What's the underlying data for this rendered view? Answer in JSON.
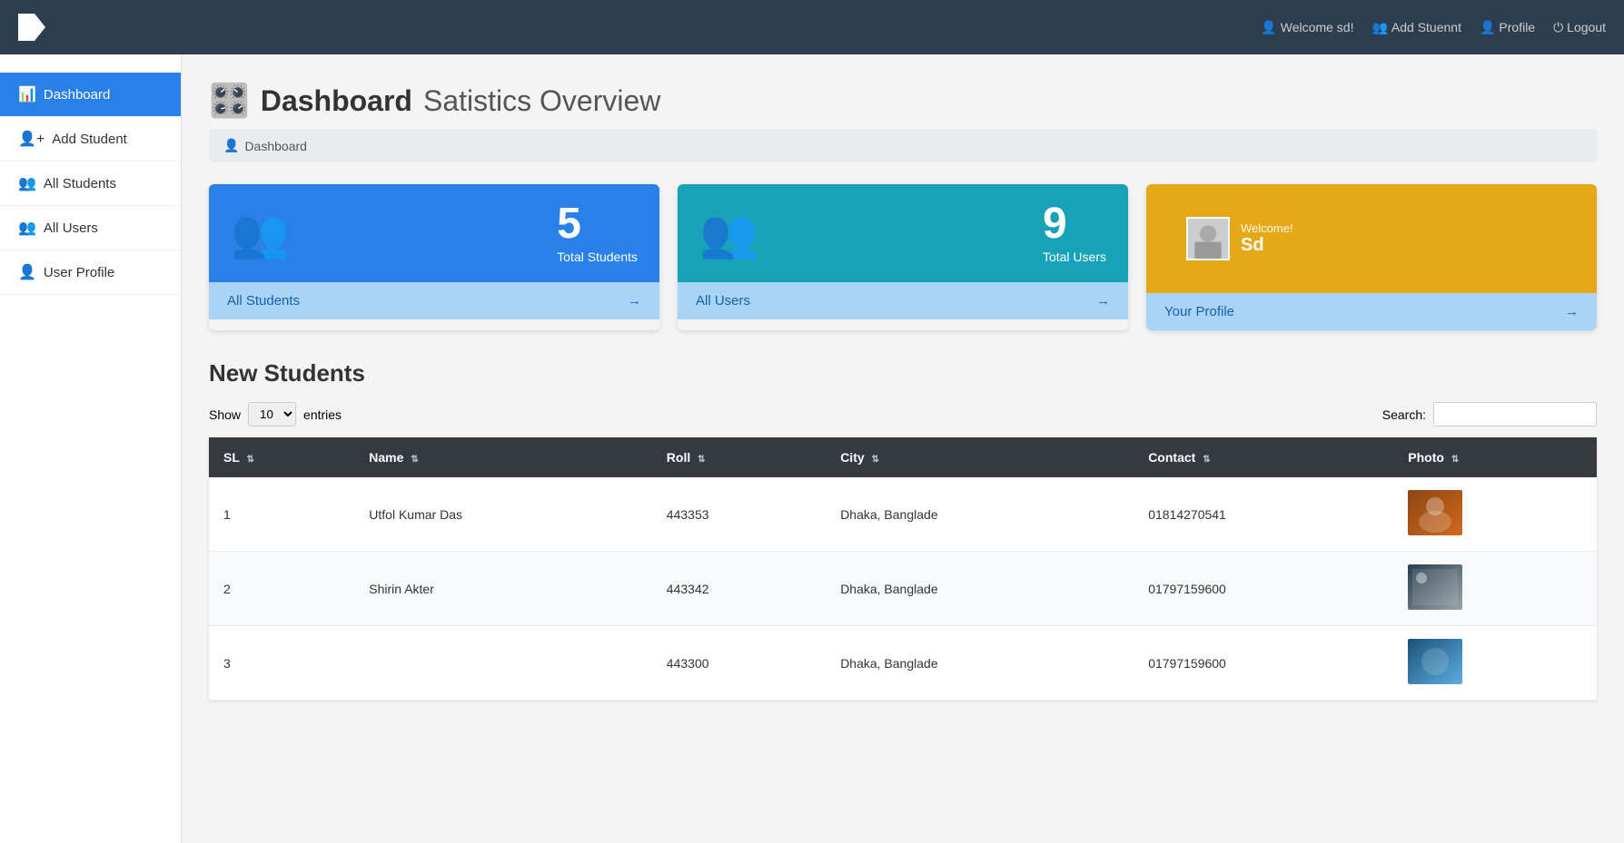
{
  "navbar": {
    "brand": "",
    "welcome_text": "Welcome sd!",
    "add_student_text": "Add Stuennt",
    "profile_text": "Profile",
    "logout_text": "Logout"
  },
  "sidebar": {
    "items": [
      {
        "id": "dashboard",
        "label": "Dashboard",
        "active": true,
        "icon": "📊"
      },
      {
        "id": "add-student",
        "label": "Add Student",
        "active": false,
        "icon": "👤"
      },
      {
        "id": "all-students",
        "label": "All Students",
        "active": false,
        "icon": "👥"
      },
      {
        "id": "all-users",
        "label": "All Users",
        "active": false,
        "icon": "👥"
      },
      {
        "id": "user-profile",
        "label": "User Profile",
        "active": false,
        "icon": "👤"
      }
    ]
  },
  "page": {
    "title_main": "Dashboard",
    "title_sub": "Satistics Overview",
    "breadcrumb": "Dashboard"
  },
  "stats": {
    "students": {
      "count": "5",
      "label": "Total Students",
      "link_text": "All Students"
    },
    "users": {
      "count": "9",
      "label": "Total Users",
      "link_text": "All Users"
    },
    "profile": {
      "welcome": "Welcome!",
      "name": "Sd",
      "link_text": "Your Profile"
    }
  },
  "table": {
    "section_title": "New Students",
    "show_label": "Show",
    "entries_label": "entries",
    "show_value": "10",
    "search_label": "Search:",
    "columns": [
      "SL",
      "Name",
      "Roll",
      "City",
      "Contact",
      "Photo"
    ],
    "rows": [
      {
        "sl": "1",
        "name": "Utfol Kumar Das",
        "roll": "443353",
        "city": "Dhaka, Banglade",
        "contact": "01814270541"
      },
      {
        "sl": "2",
        "name": "Shirin Akter",
        "roll": "443342",
        "city": "Dhaka, Banglade",
        "contact": "01797159600"
      },
      {
        "sl": "3",
        "name": "",
        "roll": "443300",
        "city": "Dhaka, Banglade",
        "contact": "01797159600"
      }
    ]
  }
}
